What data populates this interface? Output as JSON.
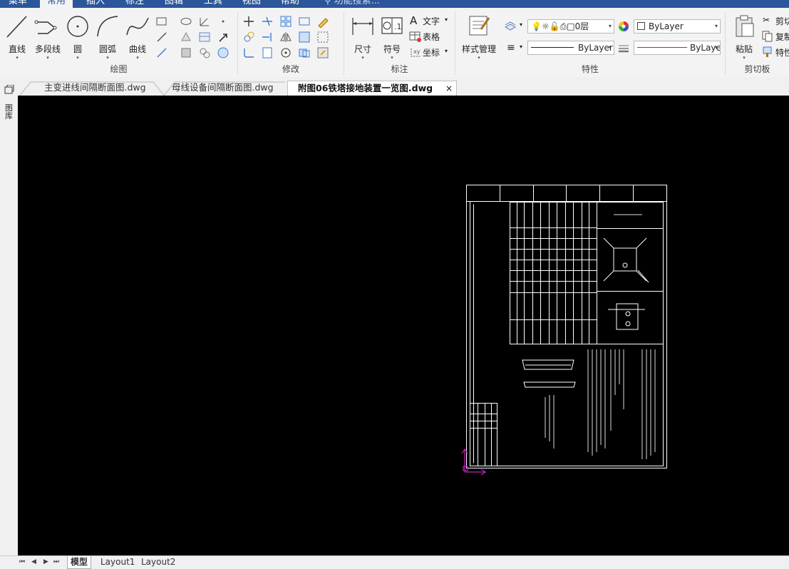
{
  "menu": {
    "items": [
      "菜单",
      "常用",
      "插入",
      "标注",
      "图辑",
      "工具",
      "视图",
      "帮助",
      "功能搜索..."
    ],
    "active": "常用"
  },
  "ribbon": {
    "draw_panel": {
      "title": "绘图",
      "buttons": [
        "直线",
        "多段线",
        "圆",
        "圆弧",
        "曲线"
      ]
    },
    "modify_panel": {
      "title": "修改"
    },
    "annotation_panel": {
      "title": "标注",
      "buttons": [
        "尺寸",
        "符号"
      ],
      "small": [
        "文字",
        "表格",
        "坐标"
      ]
    },
    "properties_panel": {
      "title": "特性",
      "style_button": "样式管理",
      "layer_value": "0层",
      "color_value": "ByLayer",
      "linetype_value": "ByLayer",
      "lineweight_value": "ByLayer"
    },
    "clipboard_panel": {
      "title": "剪切板",
      "paste": "粘贴",
      "small": [
        "剪切",
        "复制",
        "特性"
      ]
    }
  },
  "tabs": [
    {
      "label": "主变进线间隔断面图.dwg",
      "active": false
    },
    {
      "label": "母线设备间隔断面图.dwg",
      "active": false
    },
    {
      "label": "附图06铁塔接地装置一览图.dwg",
      "active": true
    }
  ],
  "tab_close": "×",
  "side_palette": {
    "label": "图库"
  },
  "layouts": {
    "nav": [
      "⏮",
      "◀",
      "▶",
      "⏭"
    ],
    "tabs": [
      "模型",
      "Layout1",
      "Layout2"
    ],
    "active": "模型"
  },
  "colors": {
    "ribbon_blue": "#2b579a",
    "canvas": "#000000",
    "drawing_lines": "#ffffff",
    "ucs_icon": "#c020c0",
    "lineweight_red": "#e01818"
  }
}
